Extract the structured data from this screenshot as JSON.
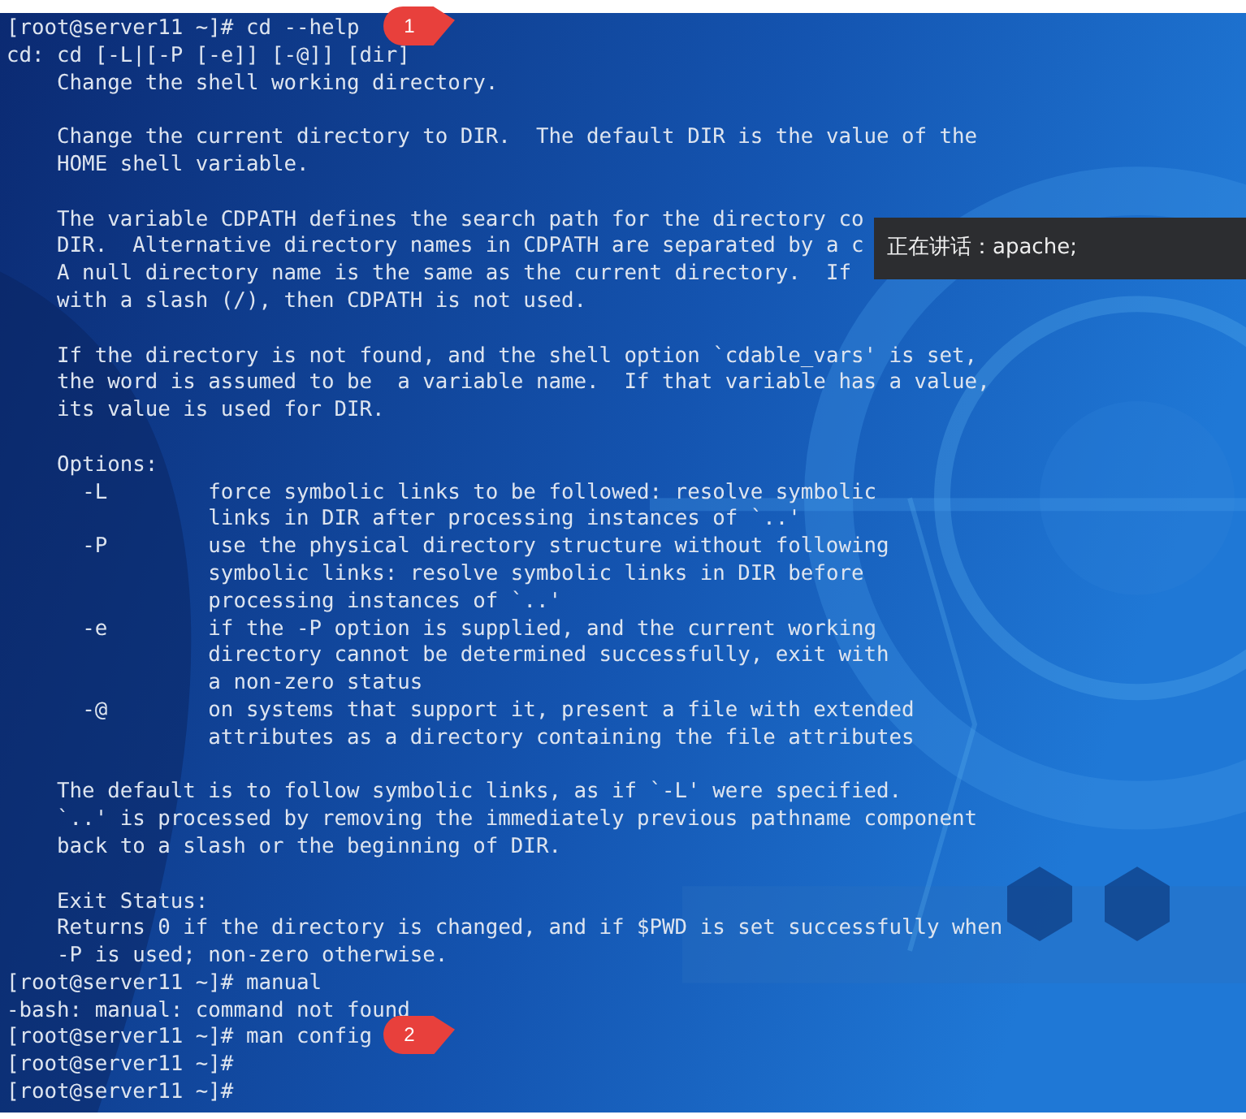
{
  "terminal": {
    "lines": [
      {
        "kind": "prompt",
        "text": "[root@server11 ~]# cd --help",
        "callout": "1"
      },
      {
        "kind": "output",
        "text": "cd: cd [-L|[-P [-e]] [-@]] [dir]"
      },
      {
        "kind": "help",
        "text": "Change the shell working directory."
      },
      {
        "kind": "blank"
      },
      {
        "kind": "help",
        "text": "Change the current directory to DIR.  The default DIR is the value of the"
      },
      {
        "kind": "help",
        "text": "HOME shell variable."
      },
      {
        "kind": "blank"
      },
      {
        "kind": "help",
        "text": "The variable CDPATH defines the search path for the directory co"
      },
      {
        "kind": "help",
        "text": "DIR.  Alternative directory names in CDPATH are separated by a c"
      },
      {
        "kind": "help",
        "text": "A null directory name is the same as the current directory.  If"
      },
      {
        "kind": "help",
        "text": "with a slash (/), then CDPATH is not used."
      },
      {
        "kind": "blank"
      },
      {
        "kind": "help",
        "text": "If the directory is not found, and the shell option `cdable_vars' is set,"
      },
      {
        "kind": "help",
        "text": "the word is assumed to be  a variable name.  If that variable has a value,"
      },
      {
        "kind": "help",
        "text": "its value is used for DIR."
      },
      {
        "kind": "blank"
      },
      {
        "kind": "help",
        "text": "Options:"
      },
      {
        "kind": "option",
        "flag": "-L",
        "text": "force symbolic links to be followed: resolve symbolic"
      },
      {
        "kind": "option_cont",
        "text": "links in DIR after processing instances of `..'"
      },
      {
        "kind": "option",
        "flag": "-P",
        "text": "use the physical directory structure without following"
      },
      {
        "kind": "option_cont",
        "text": "symbolic links: resolve symbolic links in DIR before"
      },
      {
        "kind": "option_cont",
        "text": "processing instances of `..'"
      },
      {
        "kind": "option",
        "flag": "-e",
        "text": "if the -P option is supplied, and the current working"
      },
      {
        "kind": "option_cont",
        "text": "directory cannot be determined successfully, exit with"
      },
      {
        "kind": "option_cont",
        "text": "a non-zero status"
      },
      {
        "kind": "option",
        "flag": "-@",
        "text": "on systems that support it, present a file with extended"
      },
      {
        "kind": "option_cont",
        "text": "attributes as a directory containing the file attributes"
      },
      {
        "kind": "blank"
      },
      {
        "kind": "help",
        "text": "The default is to follow symbolic links, as if `-L' were specified."
      },
      {
        "kind": "help",
        "text": "`..' is processed by removing the immediately previous pathname component"
      },
      {
        "kind": "help",
        "text": "back to a slash or the beginning of DIR."
      },
      {
        "kind": "blank"
      },
      {
        "kind": "help",
        "text": "Exit Status:"
      },
      {
        "kind": "help",
        "text": "Returns 0 if the directory is changed, and if $PWD is set successfully when"
      },
      {
        "kind": "help",
        "text": "-P is used; non-zero otherwise."
      },
      {
        "kind": "prompt",
        "text": "[root@server11 ~]# manual"
      },
      {
        "kind": "output",
        "text": "-bash: manual: command not found"
      },
      {
        "kind": "prompt",
        "text": "[root@server11 ~]# man config",
        "callout": "2"
      },
      {
        "kind": "prompt",
        "text": "[root@server11 ~]#"
      },
      {
        "kind": "prompt",
        "text": "[root@server11 ~]#"
      }
    ]
  },
  "tooltip": {
    "text": "正在讲话：apache;"
  }
}
